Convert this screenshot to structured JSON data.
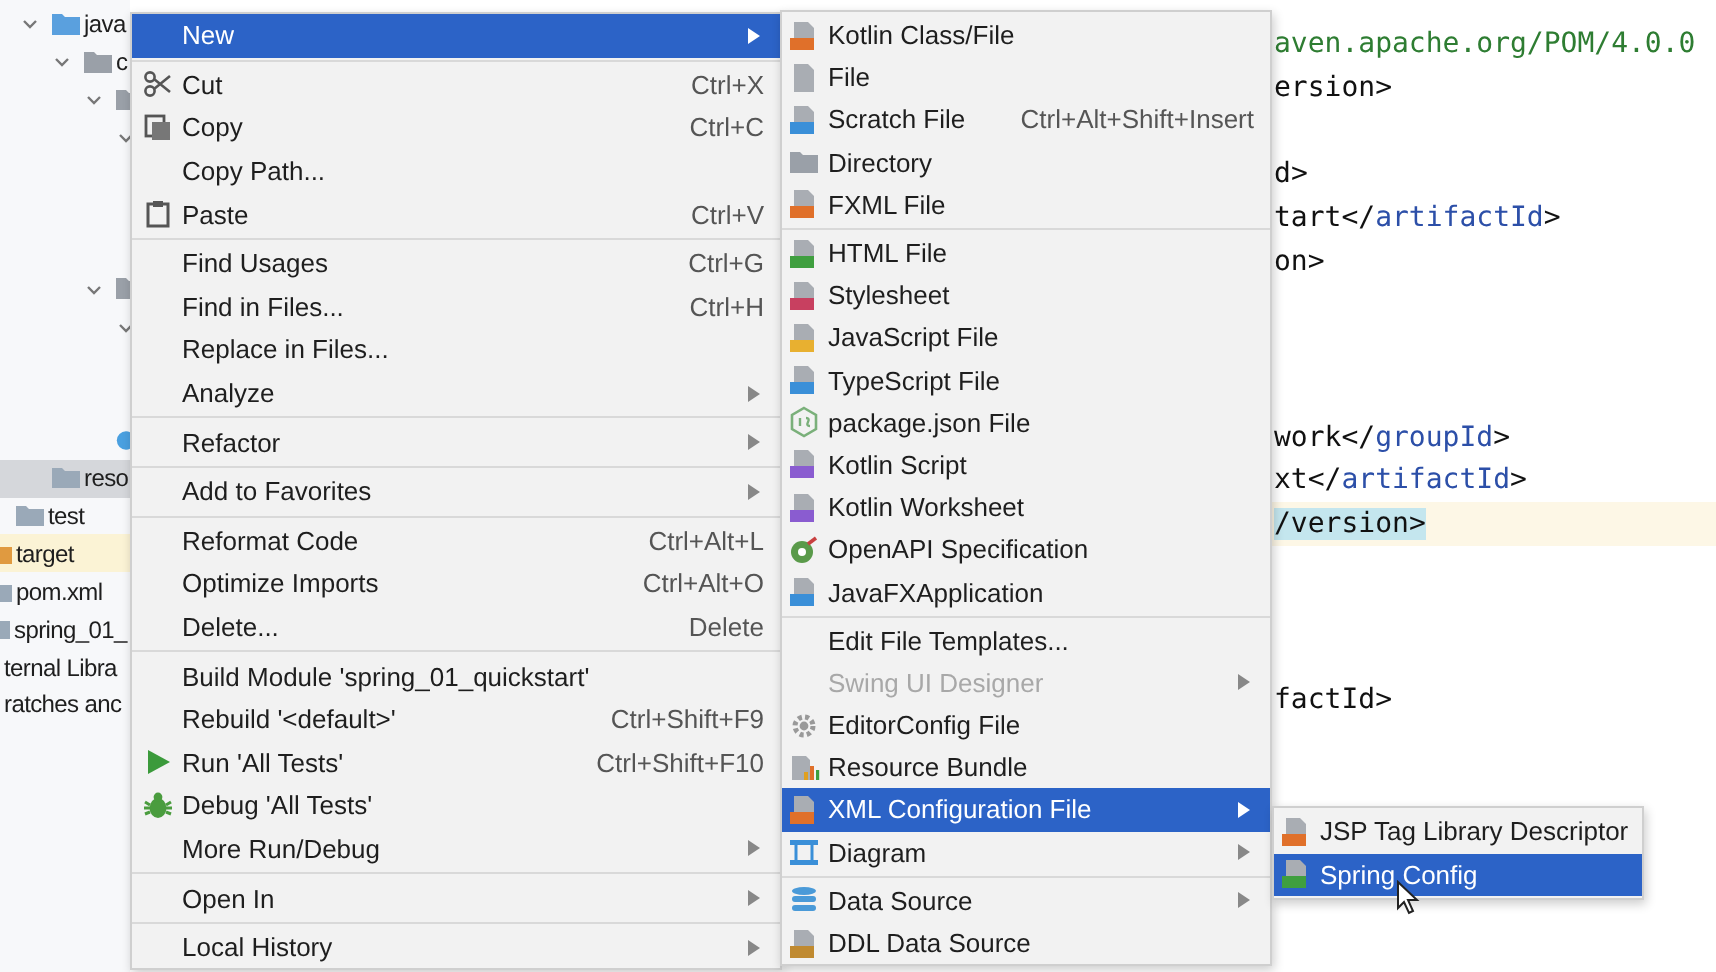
{
  "project_tree": [
    {
      "label": "java",
      "expanded": true,
      "selected": false,
      "excluded": false,
      "children": [
        {
          "label": "c",
          "expanded": true
        }
      ]
    },
    {
      "label": "reso",
      "selected": true,
      "excluded": false
    },
    {
      "label": "test",
      "selected": false,
      "excluded": false
    },
    {
      "label": "target",
      "selected": false,
      "excluded": true
    },
    {
      "label": "pom.xml",
      "selected": false,
      "excluded": false
    },
    {
      "label": "spring_01_",
      "selected": false,
      "excluded": false
    },
    {
      "label": "ternal Libra",
      "selected": false,
      "excluded": false
    },
    {
      "label": "ratches anc",
      "selected": false,
      "excluded": false
    }
  ],
  "editor": {
    "lines": [
      {
        "kind": "code",
        "text": "aven.apache.org/POM/4.0.0",
        "highlighted": false
      },
      {
        "kind": "code",
        "text": "ersion>",
        "highlighted": false
      },
      {
        "kind": "blank"
      },
      {
        "kind": "code",
        "text": "d>",
        "highlighted": false
      },
      {
        "kind": "code",
        "text": "tart</artifactId>",
        "highlighted": false
      },
      {
        "kind": "code",
        "text": "on>",
        "highlighted": false
      },
      {
        "kind": "blank"
      },
      {
        "kind": "blank"
      },
      {
        "kind": "blank"
      },
      {
        "kind": "code",
        "text": "work</groupId>",
        "highlighted": false
      },
      {
        "kind": "code",
        "text": "xt</artifactId>",
        "highlighted": false
      },
      {
        "kind": "code",
        "text": "/version>",
        "highlighted": true
      },
      {
        "kind": "blank"
      },
      {
        "kind": "blank"
      },
      {
        "kind": "blank"
      },
      {
        "kind": "code",
        "text": "factId>",
        "highlighted": false
      }
    ]
  },
  "context_menu": {
    "groups": [
      [
        {
          "label": "New",
          "has_submenu": true,
          "selected": true
        }
      ],
      [
        {
          "label": "Cut",
          "shortcut": "Ctrl+X",
          "has_submenu": false,
          "selected": false
        },
        {
          "label": "Copy",
          "shortcut": "Ctrl+C",
          "has_submenu": false,
          "selected": false
        },
        {
          "label": "Copy Path...",
          "has_submenu": false,
          "selected": false
        },
        {
          "label": "Paste",
          "shortcut": "Ctrl+V",
          "has_submenu": false,
          "selected": false
        }
      ],
      [
        {
          "label": "Find Usages",
          "shortcut": "Ctrl+G",
          "has_submenu": false,
          "selected": false
        },
        {
          "label": "Find in Files...",
          "shortcut": "Ctrl+H",
          "has_submenu": false,
          "selected": false
        },
        {
          "label": "Replace in Files...",
          "has_submenu": false,
          "selected": false
        },
        {
          "label": "Analyze",
          "has_submenu": true,
          "selected": false
        }
      ],
      [
        {
          "label": "Refactor",
          "has_submenu": true,
          "selected": false
        }
      ],
      [
        {
          "label": "Add to Favorites",
          "has_submenu": true,
          "selected": false
        }
      ],
      [
        {
          "label": "Reformat Code",
          "shortcut": "Ctrl+Alt+L",
          "has_submenu": false,
          "selected": false
        },
        {
          "label": "Optimize Imports",
          "shortcut": "Ctrl+Alt+O",
          "has_submenu": false,
          "selected": false
        },
        {
          "label": "Delete...",
          "shortcut": "Delete",
          "has_submenu": false,
          "selected": false
        }
      ],
      [
        {
          "label": "Build Module 'spring_01_quickstart'",
          "has_submenu": false,
          "selected": false
        },
        {
          "label": "Rebuild '<default>'",
          "shortcut": "Ctrl+Shift+F9",
          "has_submenu": false,
          "selected": false
        },
        {
          "label": "Run 'All Tests'",
          "shortcut": "Ctrl+Shift+F10",
          "has_submenu": false,
          "selected": false
        },
        {
          "label": "Debug 'All Tests'",
          "has_submenu": false,
          "selected": false
        },
        {
          "label": "More Run/Debug",
          "has_submenu": true,
          "selected": false
        }
      ],
      [
        {
          "label": "Open In",
          "has_submenu": true,
          "selected": false
        }
      ],
      [
        {
          "label": "Local History",
          "has_submenu": true,
          "selected": false
        }
      ]
    ]
  },
  "new_submenu": {
    "groups": [
      [
        {
          "label": "Kotlin Class/File",
          "has_submenu": false,
          "selected": false,
          "disabled": false
        },
        {
          "label": "File",
          "has_submenu": false,
          "selected": false,
          "disabled": false
        },
        {
          "label": "Scratch File",
          "shortcut": "Ctrl+Alt+Shift+Insert",
          "has_submenu": false,
          "selected": false,
          "disabled": false
        },
        {
          "label": "Directory",
          "has_submenu": false,
          "selected": false,
          "disabled": false
        },
        {
          "label": "FXML File",
          "has_submenu": false,
          "selected": false,
          "disabled": false
        }
      ],
      [
        {
          "label": "HTML File",
          "has_submenu": false,
          "selected": false,
          "disabled": false
        },
        {
          "label": "Stylesheet",
          "has_submenu": false,
          "selected": false,
          "disabled": false
        },
        {
          "label": "JavaScript File",
          "has_submenu": false,
          "selected": false,
          "disabled": false
        },
        {
          "label": "TypeScript File",
          "has_submenu": false,
          "selected": false,
          "disabled": false
        },
        {
          "label": "package.json File",
          "has_submenu": false,
          "selected": false,
          "disabled": false
        },
        {
          "label": "Kotlin Script",
          "has_submenu": false,
          "selected": false,
          "disabled": false
        },
        {
          "label": "Kotlin Worksheet",
          "has_submenu": false,
          "selected": false,
          "disabled": false
        },
        {
          "label": "OpenAPI Specification",
          "has_submenu": false,
          "selected": false,
          "disabled": false
        },
        {
          "label": "JavaFXApplication",
          "has_submenu": false,
          "selected": false,
          "disabled": false
        }
      ],
      [
        {
          "label": "Edit File Templates...",
          "has_submenu": false,
          "selected": false,
          "disabled": false
        },
        {
          "label": "Swing UI Designer",
          "has_submenu": true,
          "selected": false,
          "disabled": true
        },
        {
          "label": "EditorConfig File",
          "has_submenu": false,
          "selected": false,
          "disabled": false
        },
        {
          "label": "Resource Bundle",
          "has_submenu": false,
          "selected": false,
          "disabled": false
        },
        {
          "label": "XML Configuration File",
          "has_submenu": true,
          "selected": true,
          "disabled": false
        },
        {
          "label": "Diagram",
          "has_submenu": true,
          "selected": false,
          "disabled": false
        }
      ],
      [
        {
          "label": "Data Source",
          "has_submenu": true,
          "selected": false,
          "disabled": false
        },
        {
          "label": "DDL Data Source",
          "has_submenu": false,
          "selected": false,
          "disabled": false
        }
      ]
    ]
  },
  "xml_submenu": {
    "items": [
      {
        "label": "JSP Tag Library Descriptor",
        "selected": false
      },
      {
        "label": "Spring Config",
        "selected": true
      }
    ]
  }
}
